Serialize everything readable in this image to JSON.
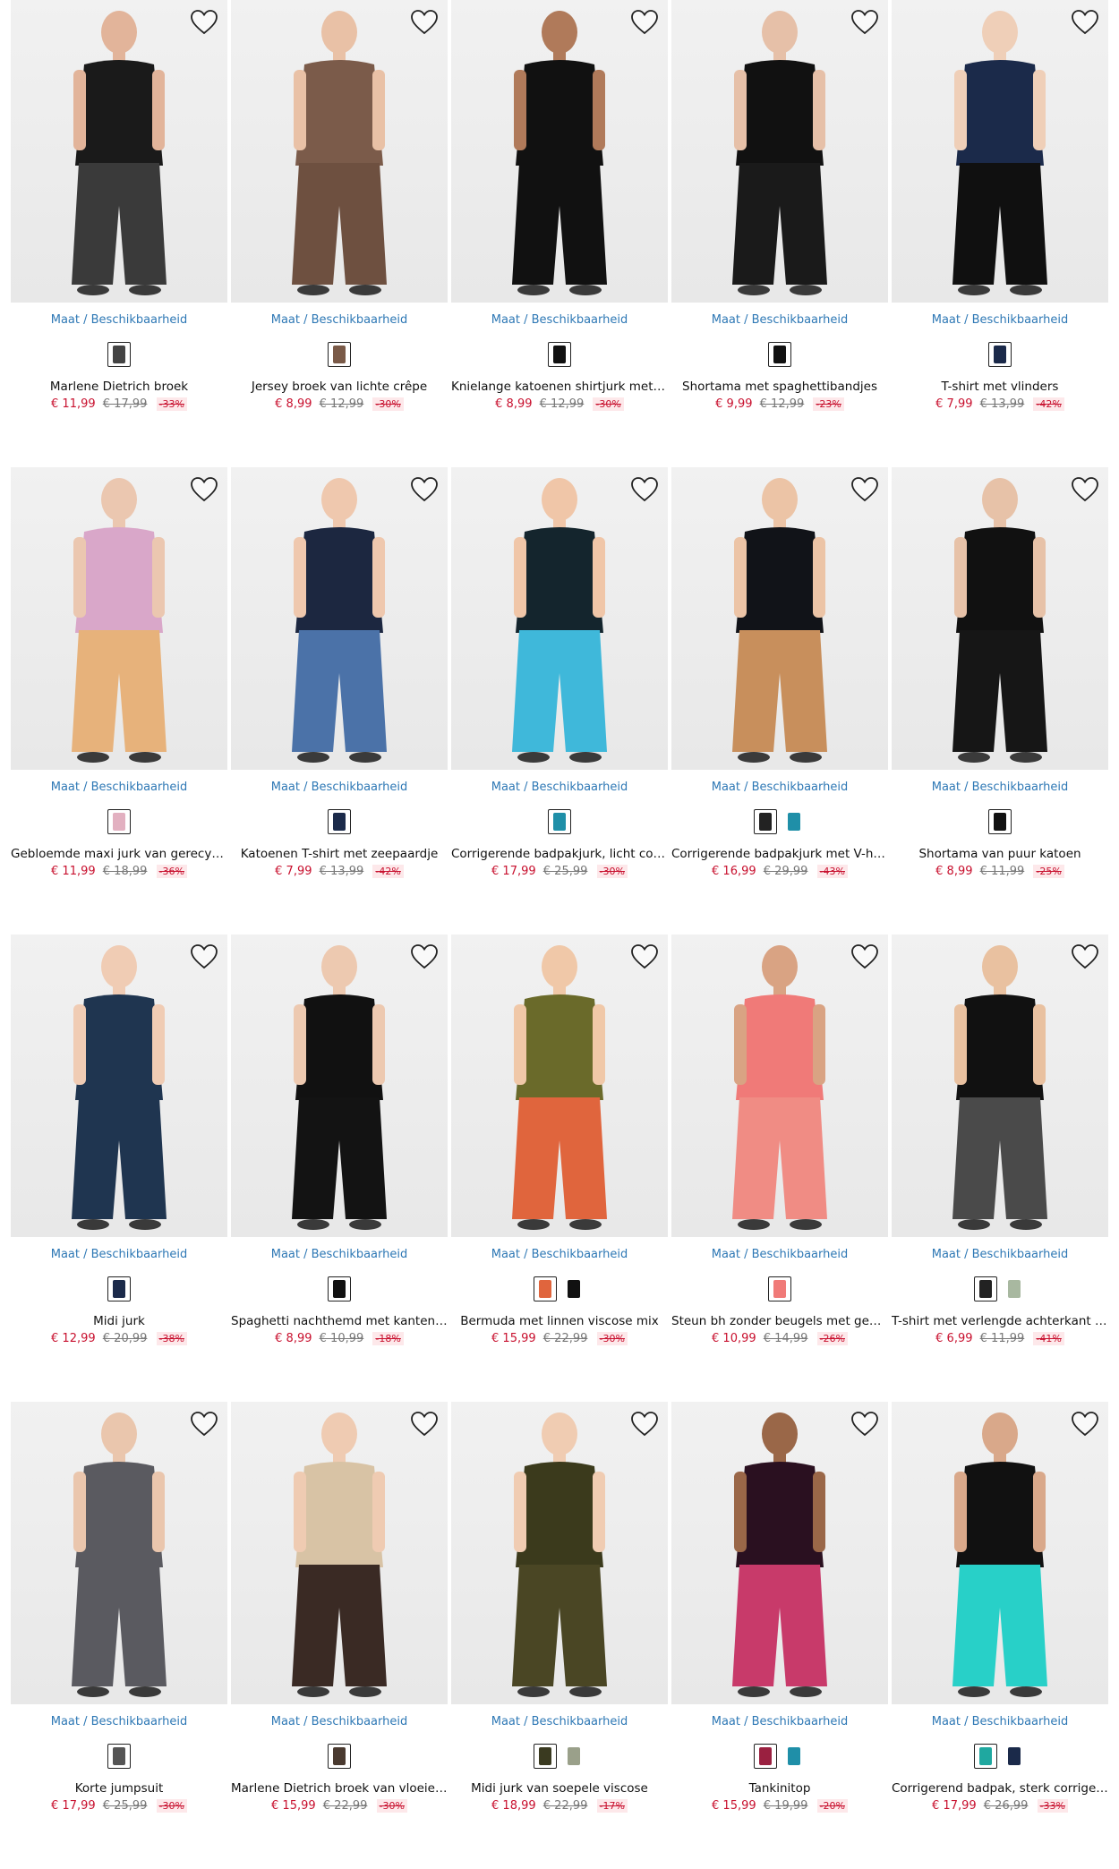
{
  "availability_label": "Maat / Beschikbaarheid",
  "products": [
    {
      "title": "Marlene Dietrich broek",
      "price": "€ 11,99",
      "old_price": "€ 17,99",
      "discount": "-33%",
      "swatches": [
        "#444444"
      ],
      "photo": {
        "top": "#1a1a1a",
        "bottom": "#3a3a3a",
        "skin": "#e2b49a"
      }
    },
    {
      "title": "Jersey broek van lichte crêpe",
      "price": "€ 8,99",
      "old_price": "€ 12,99",
      "discount": "-30%",
      "swatches": [
        "#7a5a48"
      ],
      "photo": {
        "top": "#7b5b4a",
        "bottom": "#6e5040",
        "skin": "#e9c1a6"
      }
    },
    {
      "title": "Knielange katoenen shirtjurk met korte mouwen",
      "price": "€ 8,99",
      "old_price": "€ 12,99",
      "discount": "-30%",
      "swatches": [
        "#111111"
      ],
      "photo": {
        "top": "#111111",
        "bottom": "#111111",
        "skin": "#b07a5a"
      }
    },
    {
      "title": "Shortama met spaghettibandjes",
      "price": "€ 9,99",
      "old_price": "€ 12,99",
      "discount": "-23%",
      "swatches": [
        "#111111"
      ],
      "photo": {
        "top": "#111111",
        "bottom": "#1a1a1a",
        "skin": "#e6c0a8"
      }
    },
    {
      "title": "T-shirt met vlinders",
      "price": "€ 7,99",
      "old_price": "€ 13,99",
      "discount": "-42%",
      "swatches": [
        "#1b2a4a"
      ],
      "photo": {
        "top": "#1b2a4a",
        "bottom": "#101010",
        "skin": "#efcfb8"
      }
    },
    {
      "title": "Gebloemde maxi jurk van gerecycled polyester",
      "price": "€ 11,99",
      "old_price": "€ 18,99",
      "discount": "-36%",
      "swatches": [
        "#e2b0c0"
      ],
      "photo": {
        "top": "#d9a7c9",
        "bottom": "#e7b27b",
        "skin": "#ebc7b0"
      }
    },
    {
      "title": "Katoenen T-shirt met zeepaardje",
      "price": "€ 7,99",
      "old_price": "€ 13,99",
      "discount": "-42%",
      "swatches": [
        "#1b2a4a"
      ],
      "photo": {
        "top": "#1c2740",
        "bottom": "#4b72a8",
        "skin": "#efc8ae"
      }
    },
    {
      "title": "Corrigerende badpakjurk, licht corrigerend",
      "price": "€ 17,99",
      "old_price": "€ 25,99",
      "discount": "-30%",
      "swatches": [
        "#1f8fa8"
      ],
      "photo": {
        "top": "#14252d",
        "bottom": "#3fb8da",
        "skin": "#f0c6a8"
      }
    },
    {
      "title": "Corrigerende badpakjurk met V-hals",
      "price": "€ 16,99",
      "old_price": "€ 29,99",
      "discount": "-43%",
      "swatches": [
        "#222222",
        "#1f8fa8"
      ],
      "photo": {
        "top": "#111318",
        "bottom": "#c88f5c",
        "skin": "#ecc4a6"
      }
    },
    {
      "title": "Shortama van puur katoen",
      "price": "€ 8,99",
      "old_price": "€ 11,99",
      "discount": "-25%",
      "swatches": [
        "#111111"
      ],
      "photo": {
        "top": "#111111",
        "bottom": "#161616",
        "skin": "#e7c2a8"
      }
    },
    {
      "title": "Midi jurk",
      "price": "€ 12,99",
      "old_price": "€ 20,99",
      "discount": "-38%",
      "swatches": [
        "#1b2a4a"
      ],
      "photo": {
        "top": "#1f3550",
        "bottom": "#1f3550",
        "skin": "#f0ccb4"
      }
    },
    {
      "title": "Spaghetti nachthemd met kanten rug",
      "price": "€ 8,99",
      "old_price": "€ 10,99",
      "discount": "-18%",
      "swatches": [
        "#111111"
      ],
      "photo": {
        "top": "#111111",
        "bottom": "#131313",
        "skin": "#edc9b0"
      }
    },
    {
      "title": "Bermuda met linnen viscose mix",
      "price": "€ 15,99",
      "old_price": "€ 22,99",
      "discount": "-30%",
      "swatches": [
        "#e0653d",
        "#111111"
      ],
      "photo": {
        "top": "#6a6a2a",
        "bottom": "#e0653d",
        "skin": "#f0c8a8"
      }
    },
    {
      "title": "Steun bh zonder beugels met gewatteerde cups",
      "price": "€ 10,99",
      "old_price": "€ 14,99",
      "discount": "-26%",
      "swatches": [
        "#f07a78"
      ],
      "photo": {
        "top": "#f07a78",
        "bottom": "#f08c84",
        "skin": "#d9a383"
      }
    },
    {
      "title": "T-shirt met verlengde achterkant van katoen",
      "price": "€ 6,99",
      "old_price": "€ 11,99",
      "discount": "-41%",
      "swatches": [
        "#222222",
        "#a8b8a0"
      ],
      "photo": {
        "top": "#111111",
        "bottom": "#4a4a4a",
        "skin": "#e9c1a0"
      }
    },
    {
      "title": "Korte jumpsuit",
      "price": "€ 17,99",
      "old_price": "€ 25,99",
      "discount": "-30%",
      "swatches": [
        "#555555"
      ],
      "photo": {
        "top": "#5a5a60",
        "bottom": "#5a5a60",
        "skin": "#eac6ad"
      }
    },
    {
      "title": "Marlene Dietrich broek van vloeiende viscose",
      "price": "€ 15,99",
      "old_price": "€ 22,99",
      "discount": "-30%",
      "swatches": [
        "#4a3a30"
      ],
      "photo": {
        "top": "#d8c3a5",
        "bottom": "#3a2a24",
        "skin": "#efcbb2"
      }
    },
    {
      "title": "Midi jurk van soepele viscose",
      "price": "€ 18,99",
      "old_price": "€ 22,99",
      "discount": "-17%",
      "swatches": [
        "#3a3a20",
        "#9aa08a"
      ],
      "photo": {
        "top": "#3b3a1c",
        "bottom": "#4a4624",
        "skin": "#f0ccb2"
      }
    },
    {
      "title": "Tankinitop",
      "price": "€ 15,99",
      "old_price": "€ 19,99",
      "discount": "-20%",
      "swatches": [
        "#9a2040",
        "#1f8fa8"
      ],
      "photo": {
        "top": "#2a1020",
        "bottom": "#c83a6a",
        "skin": "#9a6748"
      }
    },
    {
      "title": "Corrigerend badpak, sterk corrigerend",
      "price": "€ 17,99",
      "old_price": "€ 26,99",
      "discount": "-33%",
      "swatches": [
        "#1fa8a0",
        "#1b2a4a"
      ],
      "photo": {
        "top": "#111111",
        "bottom": "#28d0c8",
        "skin": "#d9a88a"
      }
    }
  ]
}
